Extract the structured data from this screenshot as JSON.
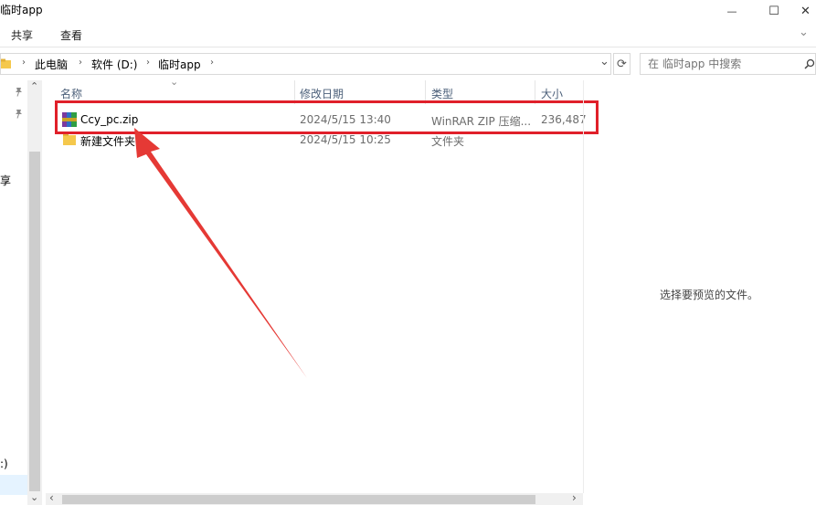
{
  "window": {
    "title": "临时app",
    "minimize_glyph": "—",
    "maximize_glyph": "☐",
    "close_glyph": "✕"
  },
  "ribbon": {
    "tabs": [
      "共享",
      "查看"
    ],
    "expand_glyph": "⌄"
  },
  "address": {
    "crumbs": [
      "此电脑",
      "软件 (D:)",
      "临时app"
    ],
    "separator": "›",
    "dropdown_glyph": "⌄",
    "refresh_glyph": "⟳"
  },
  "search": {
    "placeholder": "在 临时app 中搜索",
    "icon": "search-icon"
  },
  "nav": {
    "up_glyph": "⌃",
    "down_glyph": "⌄",
    "partial_label_1": "享",
    "partial_label_2": ":)"
  },
  "columns": {
    "name": "名称",
    "modified": "修改日期",
    "type": "类型",
    "size": "大小",
    "sort_glyph": "⌄"
  },
  "files": [
    {
      "name": "Ccy_pc.zip",
      "modified": "2024/5/15 13:40",
      "type": "WinRAR ZIP 压缩...",
      "size": "236,487",
      "icon": "winrar-archive-icon"
    },
    {
      "name": "新建文件夹",
      "modified": "2024/5/15 10:25",
      "type": "文件夹",
      "size": "",
      "icon": "folder-icon"
    }
  ],
  "preview": {
    "text": "选择要预览的文件。"
  },
  "scroll": {
    "left_glyph": "‹",
    "right_glyph": "›"
  },
  "colors": {
    "highlight": "#e0202a",
    "folder": "#f5c84c",
    "arrow": "#e53935"
  }
}
